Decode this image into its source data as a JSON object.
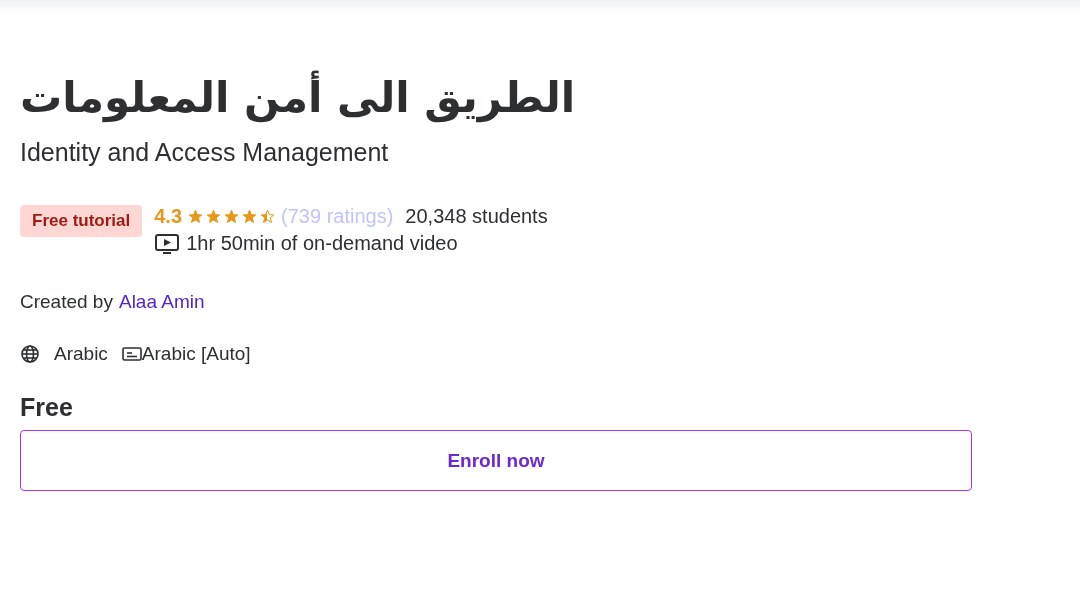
{
  "course": {
    "title": "الطريق الى أمن المعلومات",
    "subtitle": "Identity and Access Management",
    "badge": "Free tutorial",
    "rating": "4.3",
    "stars": 4.5,
    "ratings_count": "(739 ratings)",
    "students": "20,348 students",
    "duration": "1hr 50min of on-demand video",
    "created_by_label": "Created by",
    "instructor": "Alaa Amin",
    "language": "Arabic",
    "captions": "Arabic [Auto]",
    "price": "Free",
    "enroll_button": "Enroll now"
  }
}
